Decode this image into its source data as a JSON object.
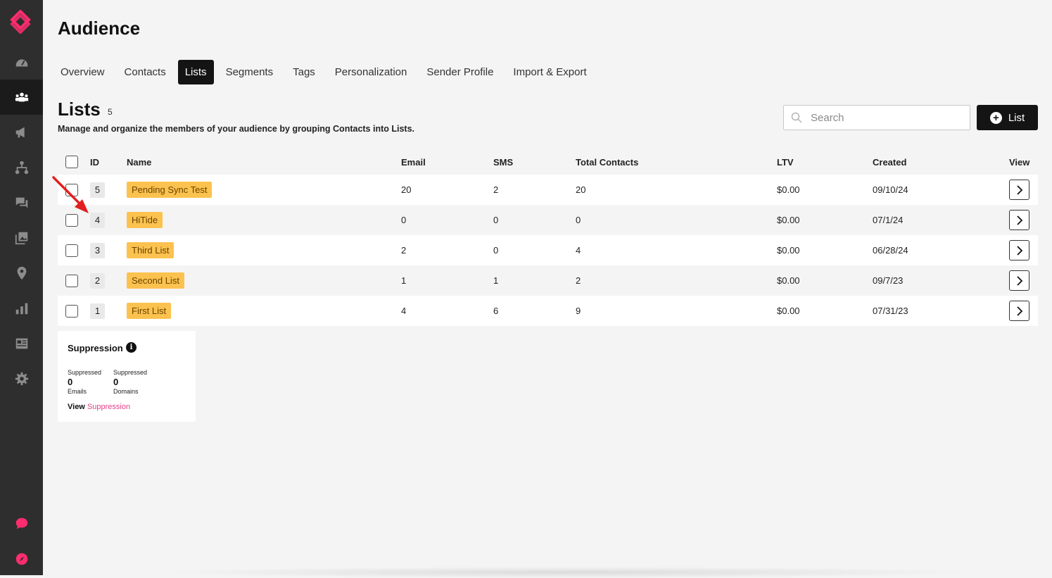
{
  "app": {
    "page_title": "Audience"
  },
  "tabs": [
    {
      "label": "Overview"
    },
    {
      "label": "Contacts"
    },
    {
      "label": "Lists"
    },
    {
      "label": "Segments"
    },
    {
      "label": "Tags"
    },
    {
      "label": "Personalization"
    },
    {
      "label": "Sender Profile"
    },
    {
      "label": "Import & Export"
    }
  ],
  "active_tab": "Lists",
  "sidebar": {
    "items": [
      {
        "icon": "dashboard-icon"
      },
      {
        "icon": "audience-icon",
        "active": true
      },
      {
        "icon": "megaphone-icon"
      },
      {
        "icon": "flow-icon"
      },
      {
        "icon": "chat-icon"
      },
      {
        "icon": "gallery-icon"
      },
      {
        "icon": "location-pin-icon"
      },
      {
        "icon": "bar-chart-icon"
      },
      {
        "icon": "newspaper-icon"
      },
      {
        "icon": "gear-icon"
      }
    ],
    "bottom_items": [
      {
        "icon": "support-chat-icon"
      },
      {
        "icon": "compass-icon"
      }
    ]
  },
  "section": {
    "title": "Lists",
    "count": "5",
    "description": "Manage and organize the members of your audience by grouping Contacts into Lists."
  },
  "search": {
    "placeholder": "Search"
  },
  "add_button": {
    "label": "List"
  },
  "table": {
    "headers": {
      "id": "ID",
      "name": "Name",
      "email": "Email",
      "sms": "SMS",
      "total": "Total Contacts",
      "ltv": "LTV",
      "created": "Created",
      "view": "View"
    },
    "rows": [
      {
        "id": "5",
        "name": "Pending Sync Test",
        "email": "20",
        "sms": "2",
        "total": "20",
        "ltv": "$0.00",
        "created": "09/10/24"
      },
      {
        "id": "4",
        "name": "HiTide",
        "email": "0",
        "sms": "0",
        "total": "0",
        "ltv": "$0.00",
        "created": "07/1/24"
      },
      {
        "id": "3",
        "name": "Third List",
        "email": "2",
        "sms": "0",
        "total": "4",
        "ltv": "$0.00",
        "created": "06/28/24"
      },
      {
        "id": "2",
        "name": "Second List",
        "email": "1",
        "sms": "1",
        "total": "2",
        "ltv": "$0.00",
        "created": "09/7/23"
      },
      {
        "id": "1",
        "name": "First List",
        "email": "4",
        "sms": "6",
        "total": "9",
        "ltv": "$0.00",
        "created": "07/31/23"
      }
    ]
  },
  "suppression": {
    "title": "Suppression",
    "info": "i",
    "emails": {
      "label": "Suppressed",
      "value": "0",
      "sub": "Emails"
    },
    "domains": {
      "label": "Suppressed",
      "value": "0",
      "sub": "Domains"
    },
    "link_prefix": "View",
    "link_text": "Suppression"
  },
  "colors": {
    "sidebar": "#2e2e2e",
    "accent_pink": "#e5408a",
    "tag_yellow": "#fcc24f",
    "annotation_arrow": "#e02020"
  }
}
